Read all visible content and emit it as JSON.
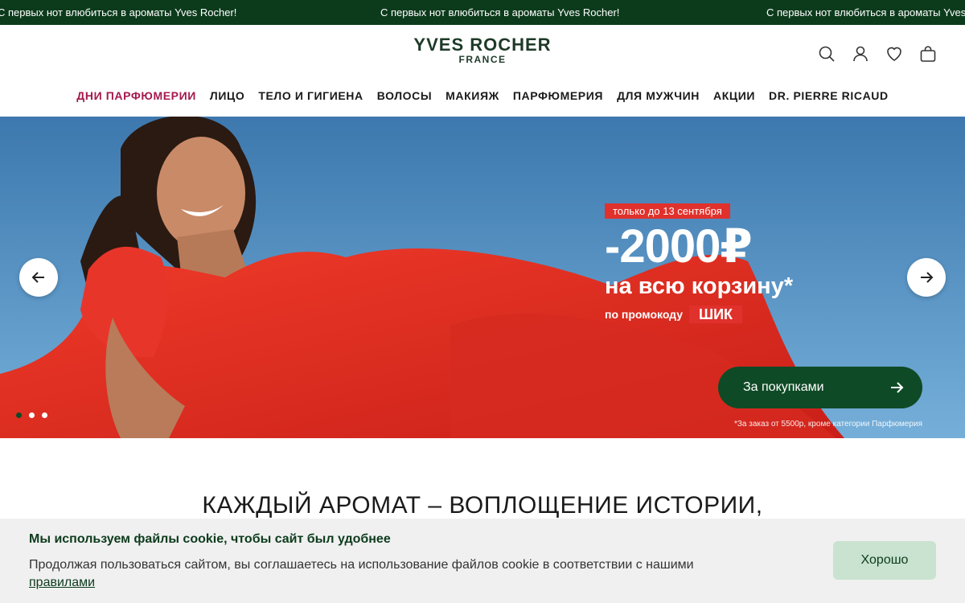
{
  "announcement": {
    "text": "С первых нот влюбиться в ароматы Yves Rocher!"
  },
  "header": {
    "brand": "YVES ROCHER",
    "brand_sub": "FRANCE",
    "icons": [
      "search-icon",
      "account-icon",
      "wishlist-icon",
      "cart-icon"
    ]
  },
  "nav": {
    "items": [
      {
        "label": "ДНИ ПАРФЮМЕРИИ",
        "accent": true
      },
      {
        "label": "ЛИЦО"
      },
      {
        "label": "ТЕЛО И ГИГИЕНА"
      },
      {
        "label": "ВОЛОСЫ"
      },
      {
        "label": "МАКИЯЖ"
      },
      {
        "label": "ПАРФЮМЕРИЯ"
      },
      {
        "label": "ДЛЯ МУЖЧИН"
      },
      {
        "label": "АКЦИИ"
      },
      {
        "label": "DR. PIERRE RICAUD"
      }
    ]
  },
  "hero": {
    "tag": "только до 13 сентября",
    "amount": "-2000₽",
    "line": "на всю корзину*",
    "code_prefix": "по промокоду",
    "code": "ШИК",
    "cta_label": "За покупками",
    "footnote": "*За заказ от 5500р, кроме категории Парфюмерия",
    "slides_total": 3,
    "active_slide": 1
  },
  "section": {
    "title": "КАЖДЫЙ АРОМАТ – ВОПЛОЩЕНИЕ ИСТОРИИ,"
  },
  "cookie": {
    "title": "Мы используем файлы cookie, чтобы сайт был удобнее",
    "text": "Продолжая пользоваться сайтом, вы соглашаетесь на использование файлов cookie в соответствии с нашими",
    "link": "правилами",
    "button": "Хорошо"
  },
  "colors": {
    "topbar": "#0c3b1c",
    "accent": "#a4194c",
    "promo_red": "#e0312c",
    "cta_green": "#0f4a26",
    "cookie_button": "#c9e3d0"
  }
}
